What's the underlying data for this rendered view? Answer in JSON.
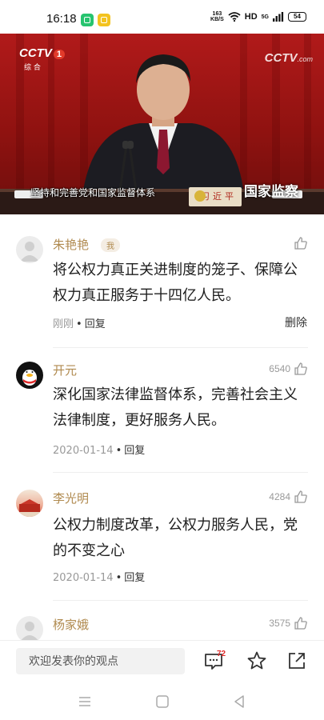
{
  "status_bar": {
    "time": "16:18",
    "net_speed_value": "163",
    "net_speed_unit": "KB/S",
    "hd_label": "HD",
    "signal_label": "5G",
    "battery": "54"
  },
  "video": {
    "channel_logo": "CCTV",
    "channel_number": "1",
    "channel_sub": "综 合",
    "watermark": "CCTV",
    "watermark_suffix": ".com",
    "caption": "坚持和完善党和国家监督体系",
    "name_plate": "习近平",
    "program_brand": "国家监察"
  },
  "comments": [
    {
      "name": "朱艳艳",
      "badge": "我",
      "likes": "",
      "text": "将公权力真正关进制度的笼子、保障公权力真正服务于十四亿人民。",
      "time": "刚刚",
      "reply_label": "回复",
      "delete_label": "删除"
    },
    {
      "name": "开元",
      "likes": "6540",
      "text": "深化国家法律监督体系，完善社会主义法律制度，更好服务人民。",
      "time": "2020-01-14",
      "reply_label": "回复"
    },
    {
      "name": "李光明",
      "likes": "4284",
      "text": "公权力制度改革，公权力服务人民，党的不变之心",
      "time": "2020-01-14",
      "reply_label": "回复"
    },
    {
      "name": "杨家娥",
      "likes": "3575"
    }
  ],
  "bottom_bar": {
    "input_placeholder": "欢迎发表你的观点",
    "comment_count": "72"
  },
  "icons": {
    "like": "thumbs-up-icon",
    "comment": "comment-icon",
    "favorite": "star-icon",
    "share": "share-icon",
    "nav_menu": "menu-icon",
    "nav_home": "home-icon",
    "nav_back": "back-icon"
  },
  "colors": {
    "username": "#b08a4f",
    "meta_gray": "#999999",
    "badge_red": "#e02b2b"
  }
}
